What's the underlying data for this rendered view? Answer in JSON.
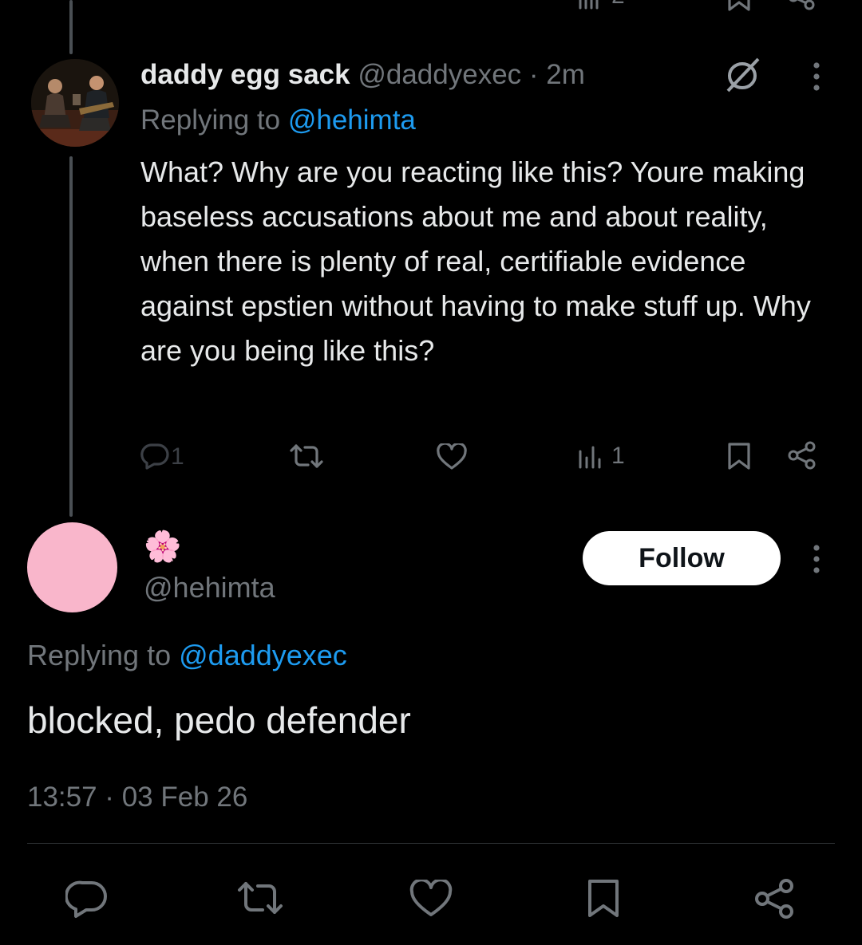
{
  "top_partial": {
    "view_count": "2"
  },
  "reply_tweet": {
    "display_name": "daddy egg sack",
    "handle": "@daddyexec",
    "separator": "·",
    "time": "2m",
    "replying_prefix": "Replying to",
    "replying_handle": "@hehimta",
    "body": "What? Why are you reacting like this? Youre making baseless accusations about me and about reality, when there is plenty of real, certifiable evidence against epstien without having to make stuff up. Why are you being like this?",
    "reply_count": "1",
    "view_count": "1"
  },
  "main_tweet": {
    "display_name": "🌸",
    "handle": "@hehimta",
    "follow_label": "Follow",
    "replying_prefix": "Replying to",
    "replying_handle": "@daddyexec",
    "body": "blocked, pedo defender",
    "timestamp": "13:57 · 03 Feb 26"
  },
  "colors": {
    "background": "#000000",
    "text": "#e7e9ea",
    "muted": "#71767b",
    "link": "#1d9bf0",
    "avatar_pink": "#f9b6cb",
    "button_bg": "#ffffff"
  },
  "icons": [
    "reply-icon",
    "retweet-icon",
    "like-icon",
    "views-icon",
    "bookmark-icon",
    "share-icon",
    "more-icon",
    "no-entry-icon"
  ]
}
